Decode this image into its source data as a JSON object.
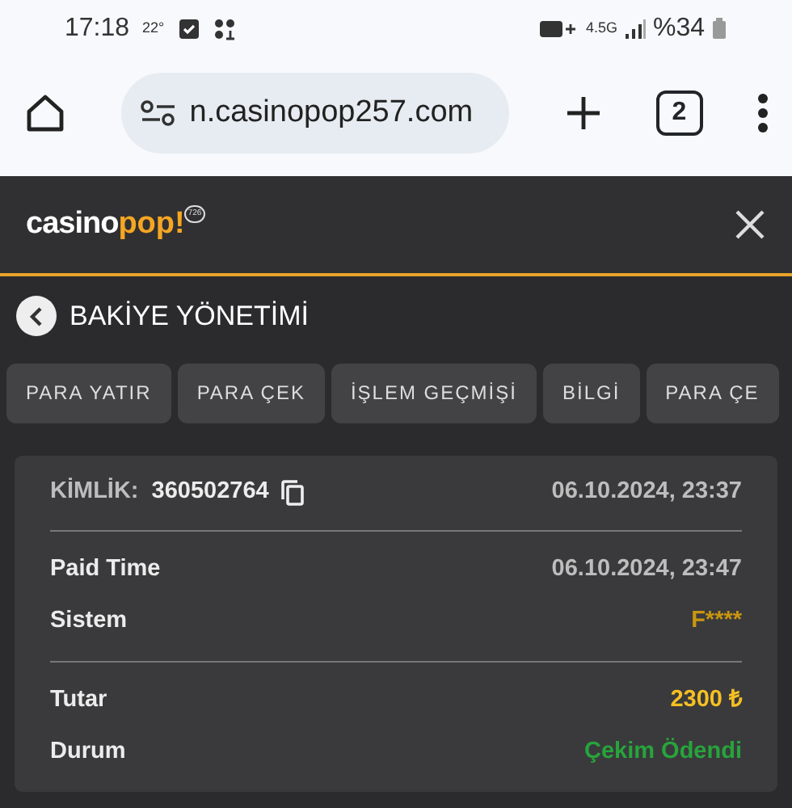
{
  "status_bar": {
    "time": "17:18",
    "temperature": "22°",
    "network": "4.5G",
    "battery": "%34"
  },
  "browser": {
    "url": "n.casinopop257.com",
    "tab_count": "2"
  },
  "site_header": {
    "logo_main": "casino",
    "logo_accent": "pop!",
    "logo_badge": "726"
  },
  "page_title": "BAKİYE YÖNETİMİ",
  "tabs": [
    {
      "label": "PARA YATIR",
      "selected": false
    },
    {
      "label": "PARA ÇEK",
      "selected": false
    },
    {
      "label": "İŞLEM GEÇMİŞİ",
      "selected": false
    },
    {
      "label": "BİLGİ",
      "selected": false
    },
    {
      "label": "PARA ÇE",
      "selected": false
    }
  ],
  "transaction": {
    "id_label": "KİMLİK:",
    "id_value": "360502764",
    "created": "06.10.2024, 23:37",
    "groups": [
      [
        {
          "label": "Paid Time",
          "value": "06.10.2024, 23:47",
          "kind": "plain"
        },
        {
          "label": "Sistem",
          "value": "F****",
          "kind": "system"
        }
      ],
      [
        {
          "label": "Tutar",
          "value": "2300 ₺",
          "kind": "amount"
        },
        {
          "label": "Durum",
          "value": "Çekim Ödendi",
          "kind": "status"
        }
      ]
    ]
  }
}
